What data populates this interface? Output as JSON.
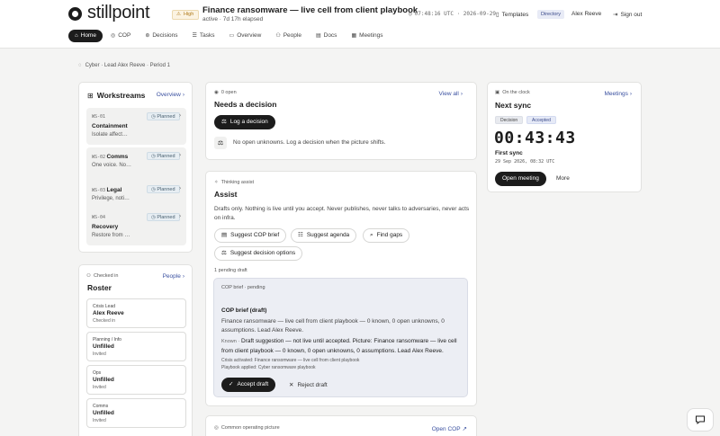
{
  "header": {
    "brand": "stillpoint",
    "severity": "High",
    "incident_title": "Finance ransomware — live cell from client playbook",
    "incident_status": "active · 7d 17h elapsed",
    "clock": "07:48:16 UTC · 2026-09-29",
    "templates_label": "Templates",
    "directory_badge": "Directory",
    "user_name": "Alex Reeve",
    "signout_label": "Sign out"
  },
  "nav": {
    "items": [
      {
        "label": "Home",
        "icon": "home-icon",
        "active": true
      },
      {
        "label": "COP",
        "icon": "globe-icon"
      },
      {
        "label": "Decisions",
        "icon": "decisions-icon"
      },
      {
        "label": "Tasks",
        "icon": "tasks-icon"
      },
      {
        "label": "Overview",
        "icon": "overview-icon"
      },
      {
        "label": "People",
        "icon": "people-icon"
      },
      {
        "label": "Docs",
        "icon": "docs-icon"
      },
      {
        "label": "Meetings",
        "icon": "calendar-icon"
      }
    ]
  },
  "breadcrumb": "Cyber · Lead Alex Reeve · Period 1",
  "workstreams": {
    "title": "Workstreams",
    "link": "Overview",
    "items": [
      {
        "code": "WS-01",
        "name": "Containment",
        "desc": "Isolate affect…",
        "status": "Planned"
      },
      {
        "code": "WS-02",
        "name": "Comms",
        "desc": "One voice. No…",
        "status": "Planned"
      },
      {
        "code": "WS-03",
        "name": "Legal",
        "desc": "Privilege, noti…",
        "status": "Planned"
      },
      {
        "code": "WS-04",
        "name": "Recovery",
        "desc": "Restore from …",
        "status": "Planned"
      }
    ]
  },
  "roster": {
    "kicker": "Checked in",
    "title": "Roster",
    "link": "People",
    "items": [
      {
        "role": "Crisis Lead",
        "name": "Alex Reeve",
        "status": "Checked in"
      },
      {
        "role": "Planning / Info",
        "name": "Unfilled",
        "status": "Invited"
      },
      {
        "role": "Ops",
        "name": "Unfilled",
        "status": "Invited"
      },
      {
        "role": "Comms",
        "name": "Unfilled",
        "status": "Invited"
      }
    ]
  },
  "decision": {
    "kicker": "0 open",
    "title": "Needs a decision",
    "link": "View all",
    "button": "Log a decision",
    "empty_text": "No open unknowns. Log a decision when the picture shifts."
  },
  "assist": {
    "kicker": "Thinking assist",
    "title": "Assist",
    "description": "Drafts only. Nothing is live until you accept. Never publishes, never talks to adversaries, never acts on infra.",
    "buttons": [
      "Suggest COP brief",
      "Suggest agenda",
      "Find gaps",
      "Suggest decision options"
    ],
    "pending_label": "1 pending draft",
    "draft": {
      "status": "COP brief · pending",
      "title": "COP brief (draft)",
      "body": "Finance ransomware — live cell from client playbook — 0 known, 0 open unknowns, 0 assumptions. Lead Alex Reeve.",
      "known_label": "Known ·",
      "known_text": "Draft suggestion — not live until accepted. Picture: Finance ransomware — live cell from client playbook — 0 known, 0 open unknowns, 0 assumptions. Lead Alex Reeve.",
      "meta1": "Crisis activated: Finance ransomware — live cell from client playbook",
      "meta2": "Playbook applied: Cyber ransomware playbook",
      "accept": "Accept draft",
      "reject": "Reject draft"
    }
  },
  "cop": {
    "kicker": "Common operating picture",
    "link": "Open COP"
  },
  "clock": {
    "kicker": "On the clock",
    "link": "Meetings",
    "title": "Next sync",
    "tags": [
      "Decision",
      "Accepted"
    ],
    "countdown": "00:43:43",
    "label": "First sync",
    "datetime": "29 Sep 2026, 08:32 UTC",
    "open_button": "Open meeting",
    "more": "More"
  },
  "colors": {
    "ink": "#1c1c1c",
    "link": "#3a50a0",
    "severity": "#b07a1a",
    "draft_bg": "#eceef4",
    "accepted": "#3a4a8a"
  }
}
